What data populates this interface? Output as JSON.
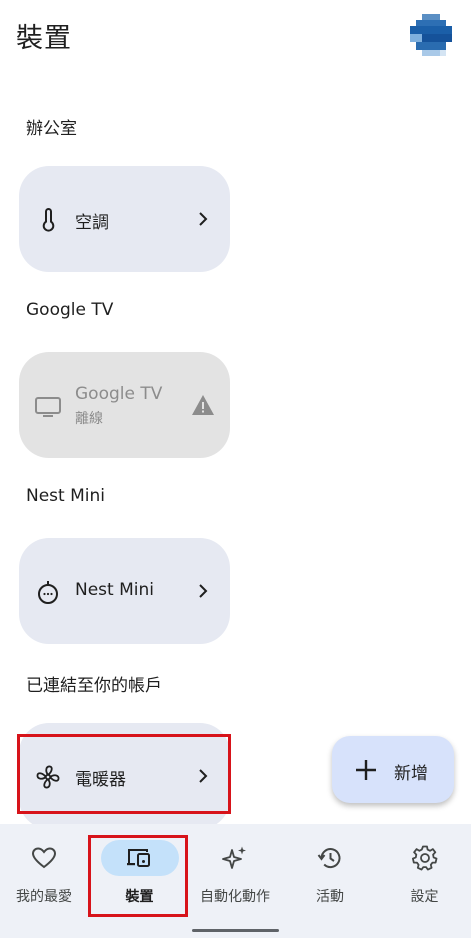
{
  "header": {
    "title": "裝置"
  },
  "sections": [
    {
      "label": "辦公室"
    },
    {
      "label": "Google TV"
    },
    {
      "label": "Nest Mini"
    },
    {
      "label": "已連結至你的帳戶"
    }
  ],
  "tiles": [
    {
      "name": "空調",
      "icon": "thermometer-icon",
      "status": "",
      "trailing": "chevron-right-icon"
    },
    {
      "name": "Google TV",
      "icon": "tv-icon",
      "status": "離線",
      "trailing": "warning-icon"
    },
    {
      "name": "Nest Mini",
      "icon": "speaker-icon",
      "status": "",
      "trailing": "chevron-right-icon"
    },
    {
      "name": "電暖器",
      "icon": "fan-icon",
      "status": "",
      "trailing": "chevron-right-icon"
    }
  ],
  "fab": {
    "label": "新增",
    "icon": "plus-icon"
  },
  "bottom_nav": {
    "active": "裝置",
    "items": [
      {
        "label": "我的最愛",
        "icon": "heart-icon"
      },
      {
        "label": "裝置",
        "icon": "devices-icon"
      },
      {
        "label": "自動化動作",
        "icon": "sparkle-icon"
      },
      {
        "label": "活動",
        "icon": "history-icon"
      },
      {
        "label": "設定",
        "icon": "gear-icon"
      }
    ]
  },
  "colors": {
    "tile_bg": "#e6e9f2",
    "tile_offline_bg": "#e3e3e3",
    "fab_bg": "#d7e2fb",
    "nav_bg": "#eef1f7",
    "nav_active_pill": "#c4e1fa",
    "highlight_box": "#d7131a"
  }
}
